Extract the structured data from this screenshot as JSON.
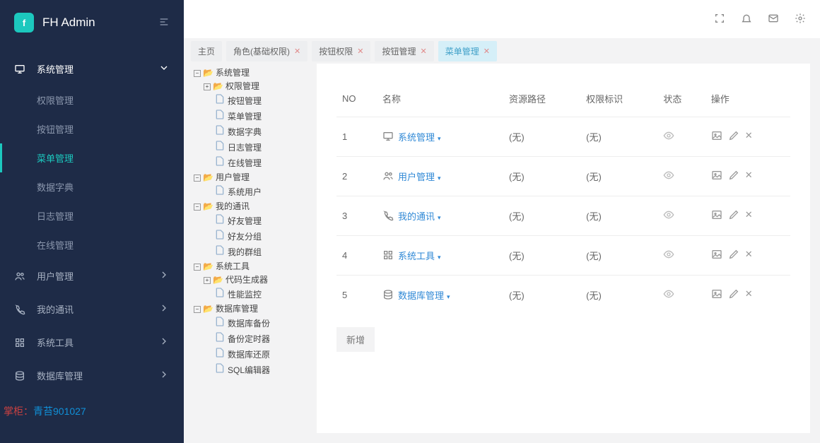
{
  "brand": {
    "name": "FH Admin",
    "logo": "f"
  },
  "nav": [
    {
      "label": "系统管理",
      "icon": "monitor",
      "expanded": true,
      "children": [
        {
          "label": "权限管理"
        },
        {
          "label": "按钮管理"
        },
        {
          "label": "菜单管理",
          "active": true
        },
        {
          "label": "数据字典"
        },
        {
          "label": "日志管理"
        },
        {
          "label": "在线管理"
        }
      ]
    },
    {
      "label": "用户管理",
      "icon": "users"
    },
    {
      "label": "我的通讯",
      "icon": "phone"
    },
    {
      "label": "系统工具",
      "icon": "grid"
    },
    {
      "label": "数据库管理",
      "icon": "db"
    }
  ],
  "tabs": [
    {
      "label": "主页"
    },
    {
      "label": "角色(基础权限)",
      "closable": true
    },
    {
      "label": "按钮权限",
      "closable": true
    },
    {
      "label": "按钮管理",
      "closable": true
    },
    {
      "label": "菜单管理",
      "closable": true,
      "active": true
    }
  ],
  "tree": [
    {
      "l": 0,
      "exp": "-",
      "t": "f",
      "label": "系统管理"
    },
    {
      "l": 1,
      "exp": "+",
      "t": "f",
      "label": "权限管理"
    },
    {
      "l": 1,
      "t": "d",
      "label": "按钮管理"
    },
    {
      "l": 1,
      "t": "d",
      "label": "菜单管理"
    },
    {
      "l": 1,
      "t": "d",
      "label": "数据字典"
    },
    {
      "l": 1,
      "t": "d",
      "label": "日志管理"
    },
    {
      "l": 1,
      "t": "d",
      "label": "在线管理"
    },
    {
      "l": 0,
      "exp": "-",
      "t": "f",
      "label": "用户管理"
    },
    {
      "l": 1,
      "t": "d",
      "label": "系统用户"
    },
    {
      "l": 0,
      "exp": "-",
      "t": "f",
      "label": "我的通讯"
    },
    {
      "l": 1,
      "t": "d",
      "label": "好友管理"
    },
    {
      "l": 1,
      "t": "d",
      "label": "好友分组"
    },
    {
      "l": 1,
      "t": "d",
      "label": "我的群组"
    },
    {
      "l": 0,
      "exp": "-",
      "t": "f",
      "label": "系统工具"
    },
    {
      "l": 1,
      "exp": "+",
      "t": "f",
      "label": "代码生成器"
    },
    {
      "l": 1,
      "t": "d",
      "label": "性能监控"
    },
    {
      "l": 0,
      "exp": "-",
      "t": "f",
      "label": "数据库管理"
    },
    {
      "l": 1,
      "t": "d",
      "label": "数据库备份"
    },
    {
      "l": 1,
      "t": "d",
      "label": "备份定时器"
    },
    {
      "l": 1,
      "t": "d",
      "label": "数据库还原"
    },
    {
      "l": 1,
      "t": "d",
      "label": "SQL编辑器"
    }
  ],
  "table": {
    "headers": {
      "no": "NO",
      "name": "名称",
      "path": "资源路径",
      "perm": "权限标识",
      "status": "状态",
      "ops": "操作"
    },
    "rows": [
      {
        "no": "1",
        "name": "系统管理",
        "icon": "monitor",
        "path": "(无)",
        "perm": "(无)"
      },
      {
        "no": "2",
        "name": "用户管理",
        "icon": "users",
        "path": "(无)",
        "perm": "(无)"
      },
      {
        "no": "3",
        "name": "我的通讯",
        "icon": "phone",
        "path": "(无)",
        "perm": "(无)"
      },
      {
        "no": "4",
        "name": "系统工具",
        "icon": "grid",
        "path": "(无)",
        "perm": "(无)"
      },
      {
        "no": "5",
        "name": "数据库管理",
        "icon": "db",
        "path": "(无)",
        "perm": "(无)"
      }
    ],
    "add": "新增"
  },
  "watermark": {
    "a": "掌柜：",
    "b": "青苔901027"
  }
}
